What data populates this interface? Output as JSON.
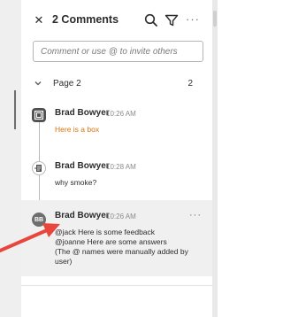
{
  "header": {
    "title": "2 Comments",
    "close_icon": "close-icon",
    "search_icon": "search-icon",
    "filter_icon": "filter-icon",
    "more_icon": "more-options-icon"
  },
  "comment_input": {
    "placeholder": "Comment or use @ to invite others",
    "value": ""
  },
  "page_group": {
    "label": "Page 2",
    "count": "2",
    "expanded": true
  },
  "comments": [
    {
      "author": "Brad Bowyer",
      "time": "10:26 AM",
      "text": "Here is a box",
      "avatar_icon": "box-annotation-icon",
      "text_color": "#d9740b"
    },
    {
      "author": "Brad Bowyer",
      "time": "10:28 AM",
      "text": "why smoke?",
      "avatar_icon": "note-annotation-icon"
    },
    {
      "author": "Brad Bowyer",
      "time": "10:26 AM",
      "initials": "BB",
      "lines": [
        "@jack Here is some feedback",
        "@joanne Here are some answers",
        "(The @ names were manually added by user)"
      ],
      "more_icon": "more-options-icon"
    }
  ],
  "colors": {
    "accent_annotation": "#d9740b",
    "selected_bg": "#f0f0f0",
    "arrow": "#e8463d"
  }
}
